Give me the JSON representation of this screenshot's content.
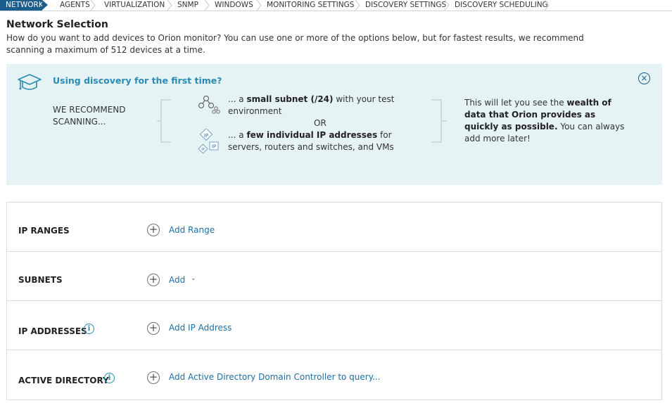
{
  "wizard": {
    "steps": [
      {
        "label": "NETWORK",
        "active": true
      },
      {
        "label": "AGENTS",
        "active": false
      },
      {
        "label": "VIRTUALIZATION",
        "active": false
      },
      {
        "label": "SNMP",
        "active": false
      },
      {
        "label": "WINDOWS",
        "active": false
      },
      {
        "label": "MONITORING SETTINGS",
        "active": false
      },
      {
        "label": "DISCOVERY SETTINGS",
        "active": false
      },
      {
        "label": "DISCOVERY SCHEDULING",
        "active": false
      }
    ]
  },
  "header": {
    "title": "Network Selection",
    "description": "How do you want to add devices to Orion monitor? You can use one or more of the options below, but for fastest results, we recommend scanning a maximum of 512 devices at a time."
  },
  "info_panel": {
    "title": "Using discovery for the first time?",
    "close_icon": "close-circle-icon",
    "recommend_label": "WE RECOMMEND SCANNING...",
    "option1": {
      "prefix": "... a ",
      "bold": "small subnet (/24)",
      "suffix": " with your test environment",
      "icon": "subnet-icon"
    },
    "or_label": "OR",
    "option2": {
      "prefix": "... a ",
      "bold": "few individual IP addresses",
      "suffix": " for servers, routers and switches, and VMs",
      "icon": "ip-address-icon"
    },
    "benefit": {
      "prefix": "This will let you see the ",
      "bold": "wealth of data that Orion provides as quickly as possible.",
      "suffix": " You can always add more later!"
    }
  },
  "sections": [
    {
      "label": "IP RANGES",
      "has_info": false,
      "action": "Add Range",
      "has_dropdown": false
    },
    {
      "label": "SUBNETS",
      "has_info": false,
      "action": "Add",
      "has_dropdown": true,
      "dropdown_glyph": "⌄"
    },
    {
      "label": "IP ADDRESSES",
      "has_info": true,
      "action": "Add IP Address",
      "has_dropdown": false
    },
    {
      "label": "ACTIVE DIRECTORY",
      "has_info": true,
      "action": "Add Active Directory Domain Controller to query...",
      "has_dropdown": false
    }
  ],
  "glyphs": {
    "plus": "+",
    "close": "×",
    "info": "i"
  },
  "colors": {
    "active_step": "#1b5d8c",
    "panel_bg": "#e6f3f5",
    "link": "#1e6fa5",
    "panel_title": "#2a8bb3"
  }
}
